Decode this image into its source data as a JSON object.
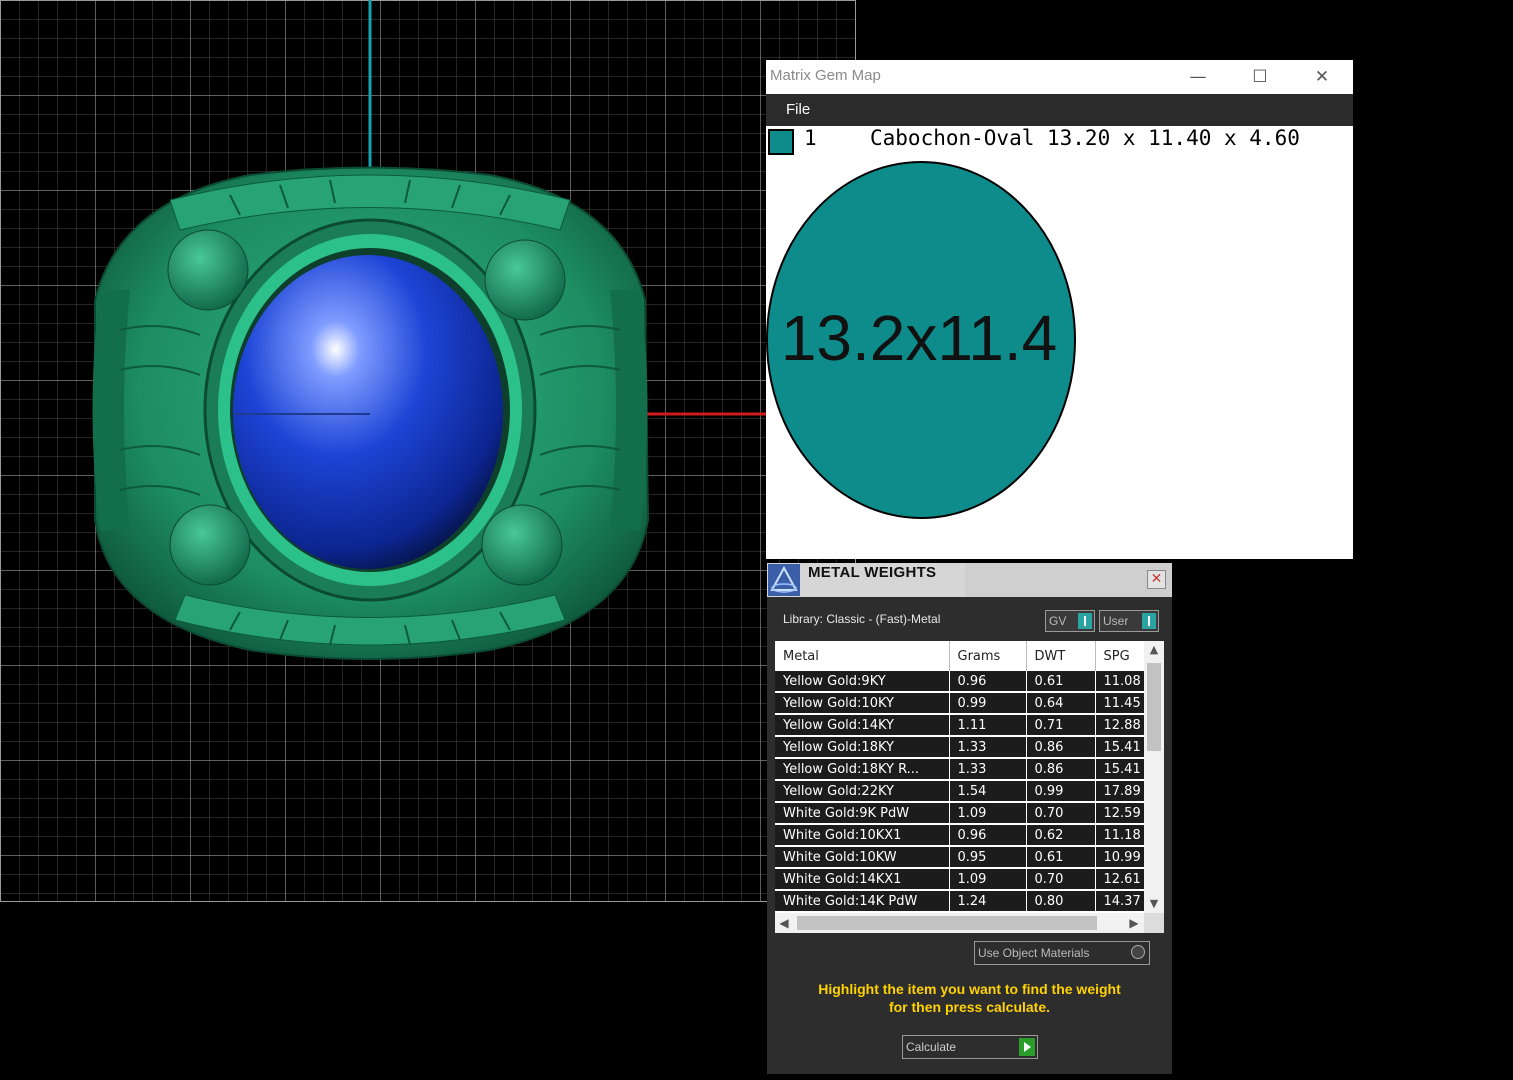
{
  "gem_map": {
    "title": "Matrix Gem Map",
    "controls": {
      "minimize": "—",
      "maximize": "☐",
      "close": "✕"
    },
    "menu": [
      "File"
    ],
    "gem": {
      "index": "1",
      "description": "Cabochon-Oval 13.20 x 11.40 x 4.60",
      "label": "13.2x11.4",
      "color": "#0e8c8c"
    }
  },
  "metal_weights": {
    "title": "METAL WEIGHTS",
    "close": "✕",
    "library": "Library: Classic - (Fast)-Metal",
    "toggles": {
      "gv": "GV",
      "user": "User"
    },
    "columns": [
      "Metal",
      "Grams",
      "DWT",
      "SPG"
    ],
    "rows": [
      [
        "Yellow Gold:9KY",
        "0.96",
        "0.61",
        "11.08"
      ],
      [
        "Yellow Gold:10KY",
        "0.99",
        "0.64",
        "11.45"
      ],
      [
        "Yellow Gold:14KY",
        "1.11",
        "0.71",
        "12.88"
      ],
      [
        "Yellow Gold:18KY",
        "1.33",
        "0.86",
        "15.41"
      ],
      [
        "Yellow Gold:18KY R...",
        "1.33",
        "0.86",
        "15.41"
      ],
      [
        "Yellow Gold:22KY",
        "1.54",
        "0.99",
        "17.89"
      ],
      [
        "White Gold:9K PdW",
        "1.09",
        "0.70",
        "12.59"
      ],
      [
        "White Gold:10KX1",
        "0.96",
        "0.62",
        "11.18"
      ],
      [
        "White Gold:10KW",
        "0.95",
        "0.61",
        "10.99"
      ],
      [
        "White Gold:14KX1",
        "1.09",
        "0.70",
        "12.61"
      ],
      [
        "White Gold:14K PdW",
        "1.24",
        "0.80",
        "14.37"
      ]
    ],
    "use_object_materials": "Use Object Materials",
    "hint_line1": "Highlight the item you want to find the weight",
    "hint_line2": "for then press calculate.",
    "calculate": "Calculate"
  },
  "colors": {
    "ring_metal": "#1f8a63",
    "gem_blue": "#1540c8",
    "axis_x": "#d11a1a",
    "axis_y": "#15a3b0",
    "grid": "#8a8a8a"
  }
}
